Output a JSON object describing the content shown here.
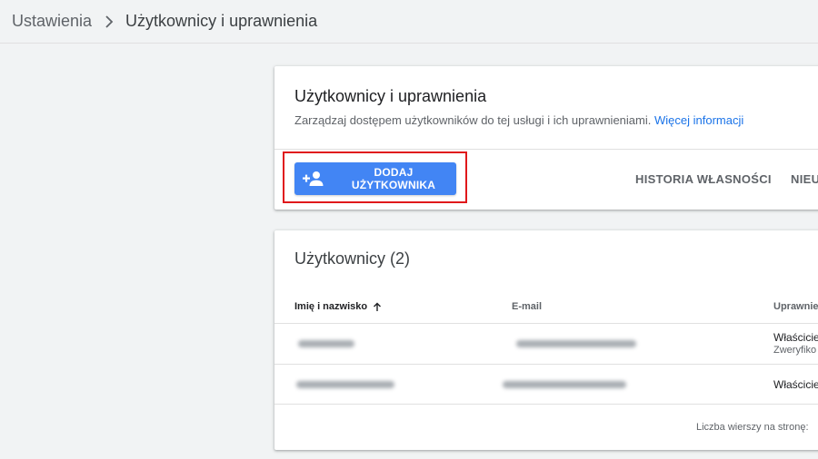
{
  "breadcrumb": {
    "parent": "Ustawienia",
    "current": "Użytkownicy i uprawnienia"
  },
  "header_card": {
    "title": "Użytkownicy i uprawnienia",
    "description": "Zarządzaj dostępem użytkowników do tej usługi i ich uprawnieniami.",
    "link": "Więcej informacji",
    "add_button": "DODAJ UŻYTKOWNIKA",
    "history_button": "HISTORIA WŁASNOŚCI",
    "other_button": "NIEU"
  },
  "users_card": {
    "title": "Użytkownicy (2)",
    "columns": {
      "name": "Imię i nazwisko",
      "email": "E-mail",
      "permissions": "Uprawnien"
    },
    "rows": [
      {
        "permission": "Właściciel",
        "status": "Zweryfiko"
      },
      {
        "permission": "Właściciel"
      }
    ],
    "footer": "Liczba wierszy na stronę:"
  },
  "colors": {
    "primary": "#4285f4",
    "link": "#1a73e8",
    "highlight": "#e0181b"
  }
}
